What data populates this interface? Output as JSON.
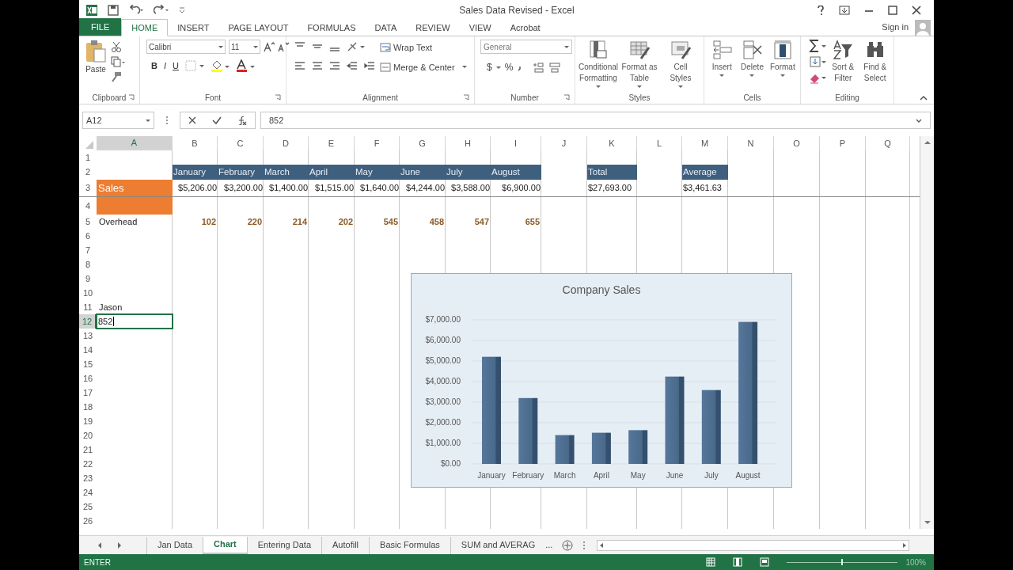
{
  "window": {
    "title": "Sales Data Revised - Excel",
    "sign_in": "Sign in"
  },
  "ribbon_tabs": [
    {
      "label": "FILE",
      "kind": "file",
      "selected": false
    },
    {
      "label": "HOME",
      "kind": "tab",
      "selected": true
    },
    {
      "label": "INSERT",
      "kind": "tab",
      "selected": false
    },
    {
      "label": "PAGE LAYOUT",
      "kind": "tab",
      "selected": false
    },
    {
      "label": "FORMULAS",
      "kind": "tab",
      "selected": false
    },
    {
      "label": "DATA",
      "kind": "tab",
      "selected": false
    },
    {
      "label": "REVIEW",
      "kind": "tab",
      "selected": false
    },
    {
      "label": "VIEW",
      "kind": "tab",
      "selected": false
    },
    {
      "label": "Acrobat",
      "kind": "tab",
      "selected": false
    }
  ],
  "ribbon": {
    "groups": [
      {
        "label": "Clipboard",
        "kind": "clipboard",
        "buttons": [
          {
            "label": "Paste"
          }
        ]
      },
      {
        "label": "Font",
        "kind": "font",
        "font_name": "Calibri",
        "font_size": "11",
        "styles": [
          "B",
          "I",
          "U"
        ]
      },
      {
        "label": "Alignment",
        "kind": "alignment",
        "buttons": [
          {
            "label": "Wrap Text"
          },
          {
            "label": "Merge & Center"
          }
        ]
      },
      {
        "label": "Number",
        "kind": "number",
        "format": "General",
        "symbols": [
          "$",
          "%"
        ]
      },
      {
        "label": "Styles",
        "kind": "large",
        "buttons": [
          {
            "label": "Conditional Formatting"
          },
          {
            "label": "Format as Table"
          },
          {
            "label": "Cell Styles"
          }
        ]
      },
      {
        "label": "Cells",
        "kind": "large",
        "buttons": [
          {
            "label": "Insert"
          },
          {
            "label": "Delete"
          },
          {
            "label": "Format"
          }
        ]
      },
      {
        "label": "Editing",
        "kind": "editing",
        "buttons": [
          {
            "label": "Sort & Filter"
          },
          {
            "label": "Find & Select"
          }
        ]
      }
    ]
  },
  "formula_bar": {
    "name_box": "A12",
    "value": "852"
  },
  "columns": [
    {
      "label": "A",
      "selected": true
    },
    {
      "label": "B",
      "selected": false
    },
    {
      "label": "C",
      "selected": false
    },
    {
      "label": "D",
      "selected": false
    },
    {
      "label": "E",
      "selected": false
    },
    {
      "label": "F",
      "selected": false
    },
    {
      "label": "G",
      "selected": false
    },
    {
      "label": "H",
      "selected": false
    },
    {
      "label": "I",
      "selected": false
    },
    {
      "label": "J",
      "selected": false
    },
    {
      "label": "K",
      "selected": false
    },
    {
      "label": "L",
      "selected": false
    },
    {
      "label": "M",
      "selected": false
    },
    {
      "label": "N",
      "selected": false
    },
    {
      "label": "O",
      "selected": false
    },
    {
      "label": "P",
      "selected": false
    },
    {
      "label": "Q",
      "selected": false
    }
  ],
  "rows": [
    {
      "number": "1",
      "selected": false
    },
    {
      "number": "2",
      "selected": false,
      "cells": [
        {
          "kind": "blank"
        },
        {
          "kind": "header",
          "text": "January"
        },
        {
          "kind": "header",
          "text": "February"
        },
        {
          "kind": "header",
          "text": "March"
        },
        {
          "kind": "header",
          "text": "April"
        },
        {
          "kind": "header",
          "text": "May"
        },
        {
          "kind": "header",
          "text": "June"
        },
        {
          "kind": "header",
          "text": "July"
        },
        {
          "kind": "header",
          "text": "August"
        },
        {
          "kind": "blank"
        },
        {
          "kind": "header",
          "text": "Total"
        },
        {
          "kind": "blank"
        },
        {
          "kind": "header",
          "text": "Average"
        }
      ]
    },
    {
      "number": "3",
      "selected": false,
      "cells": [
        {
          "kind": "sales",
          "text": "Sales"
        },
        {
          "kind": "currency",
          "text": "$5,206.00"
        },
        {
          "kind": "currency",
          "text": "$3,200.00"
        },
        {
          "kind": "currency",
          "text": "$1,400.00"
        },
        {
          "kind": "currency",
          "text": "$1,515.00"
        },
        {
          "kind": "currency",
          "text": "$1,640.00"
        },
        {
          "kind": "currency",
          "text": "$4,244.00"
        },
        {
          "kind": "currency",
          "text": "$3,588.00"
        },
        {
          "kind": "currency",
          "text": "$6,900.00"
        },
        {
          "kind": "blank"
        },
        {
          "kind": "total",
          "text": "$27,693.00"
        },
        {
          "kind": "blank"
        },
        {
          "kind": "total",
          "text": "$3,461.63"
        }
      ]
    },
    {
      "number": "4",
      "selected": false,
      "cells": [
        {
          "kind": "fill"
        }
      ]
    },
    {
      "number": "5",
      "selected": false,
      "cells": [
        {
          "kind": "text",
          "text": "Overhead"
        },
        {
          "kind": "number",
          "text": "102"
        },
        {
          "kind": "number",
          "text": "220"
        },
        {
          "kind": "number",
          "text": "214"
        },
        {
          "kind": "number",
          "text": "202"
        },
        {
          "kind": "number",
          "text": "545"
        },
        {
          "kind": "number",
          "text": "458"
        },
        {
          "kind": "number",
          "text": "547"
        },
        {
          "kind": "number",
          "text": "655"
        }
      ]
    },
    {
      "number": "6",
      "selected": false
    },
    {
      "number": "7",
      "selected": false
    },
    {
      "number": "8",
      "selected": false
    },
    {
      "number": "9",
      "selected": false
    },
    {
      "number": "10",
      "selected": false
    },
    {
      "number": "11",
      "selected": false,
      "cells": [
        {
          "kind": "text",
          "text": "Jason"
        }
      ]
    },
    {
      "number": "12",
      "selected": true,
      "cells": [
        {
          "kind": "active",
          "text": "852"
        }
      ]
    },
    {
      "number": "13",
      "selected": false
    },
    {
      "number": "14",
      "selected": false
    },
    {
      "number": "15",
      "selected": false
    },
    {
      "number": "16",
      "selected": false
    },
    {
      "number": "17",
      "selected": false
    },
    {
      "number": "18",
      "selected": false
    },
    {
      "number": "19",
      "selected": false
    },
    {
      "number": "20",
      "selected": false
    },
    {
      "number": "21",
      "selected": false
    },
    {
      "number": "22",
      "selected": false
    },
    {
      "number": "23",
      "selected": false
    },
    {
      "number": "24",
      "selected": false
    },
    {
      "number": "25",
      "selected": false
    },
    {
      "number": "26",
      "selected": false
    }
  ],
  "chart": {
    "chart_data": {
      "type": "bar",
      "title": "Company Sales",
      "categories": [
        "January",
        "February",
        "March",
        "April",
        "May",
        "June",
        "July",
        "August"
      ],
      "values": [
        5206,
        3200,
        1400,
        1515,
        1640,
        4244,
        3588,
        6900
      ],
      "ylim": [
        0,
        7000
      ],
      "grid": true,
      "yticks": [
        {
          "value": 0,
          "label": "$0.00"
        },
        {
          "value": 1000,
          "label": "$1,000.00"
        },
        {
          "value": 2000,
          "label": "$2,000.00"
        },
        {
          "value": 3000,
          "label": "$3,000.00"
        },
        {
          "value": 4000,
          "label": "$4,000.00"
        },
        {
          "value": 5000,
          "label": "$5,000.00"
        },
        {
          "value": 6000,
          "label": "$6,000.00"
        },
        {
          "value": 7000,
          "label": "$7,000.00"
        }
      ]
    }
  },
  "sheet_tabs": [
    {
      "label": "Jan Data",
      "selected": false
    },
    {
      "label": "Chart",
      "selected": true
    },
    {
      "label": "Entering Data",
      "selected": false
    },
    {
      "label": "Autofill",
      "selected": false
    },
    {
      "label": "Basic Formulas",
      "selected": false
    },
    {
      "label": "SUM and AVERAG",
      "selected": false
    }
  ],
  "more_tabs": "...",
  "status_bar": {
    "mode": "ENTER",
    "zoom_slider": {
      "level": 0.5
    },
    "zoom": "100%"
  }
}
